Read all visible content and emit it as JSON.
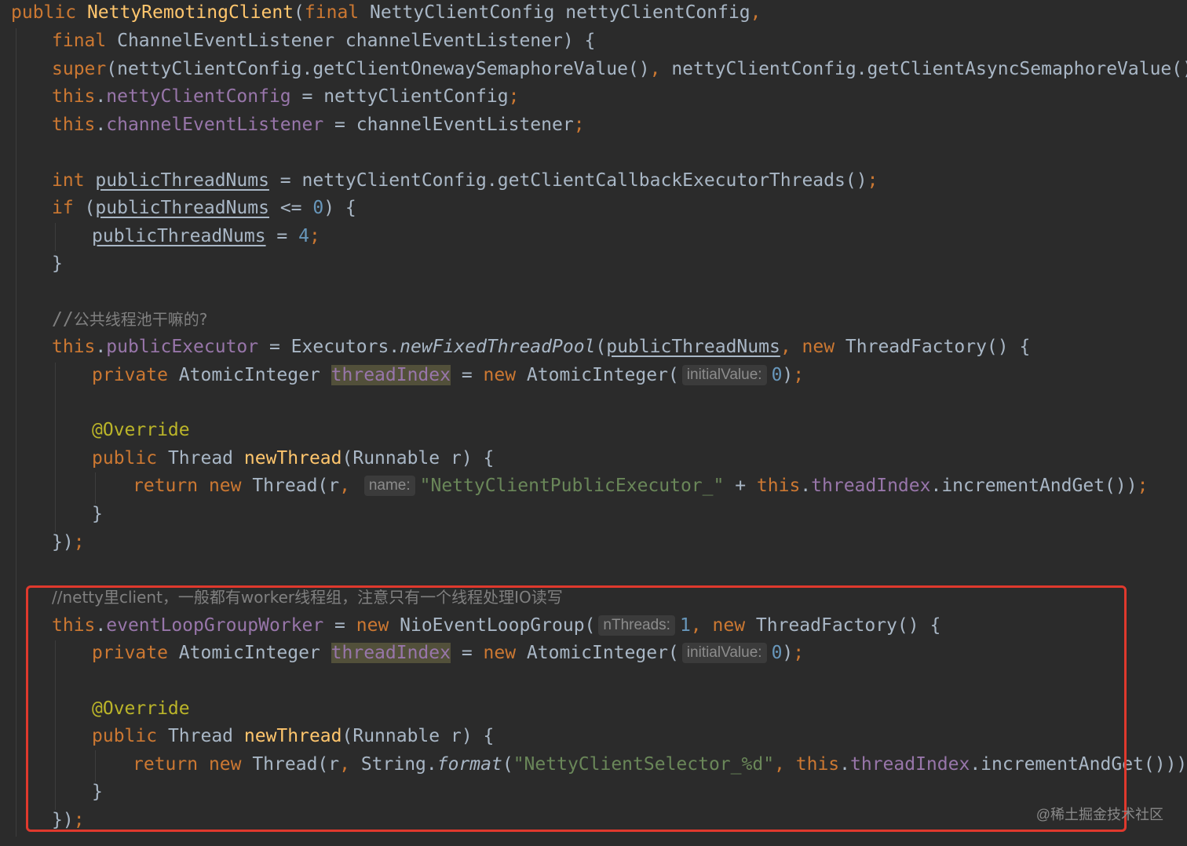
{
  "code": {
    "l1": {
      "kw_public": "public ",
      "ctor": "NettyRemotingClient",
      "lp": "(",
      "kw_final": "final ",
      "rest": "NettyClientConfig nettyClientConfig",
      "comma": ","
    },
    "l2": {
      "kw_final": "final ",
      "rest": "ChannelEventListener channelEventListener) {"
    },
    "l3": {
      "kw_super": "super",
      "mid": "(nettyClientConfig.getClientOnewaySemaphoreValue()",
      "comma": ", ",
      "rest": "nettyClientConfig.getClientAsyncSemaphoreValue())",
      "semi": ";"
    },
    "l4": {
      "this": "this",
      "dot": ".",
      "field": "nettyClientConfig",
      "rest": " = nettyClientConfig",
      "semi": ";"
    },
    "l5": {
      "this": "this",
      "dot": ".",
      "field": "channelEventListener",
      "rest": " = channelEventListener",
      "semi": ";"
    },
    "l6": {
      "kw_int": "int ",
      "var": "publicThreadNums",
      "rest": " = nettyClientConfig.getClientCallbackExecutorThreads()",
      "semi": ";"
    },
    "l7": {
      "kw_if": "if ",
      "lp": "(",
      "var": "publicThreadNums",
      "op": " <= ",
      "num": "0",
      "rest": ") {"
    },
    "l8": {
      "var": "publicThreadNums",
      "op": " = ",
      "num": "4",
      "semi": ";"
    },
    "l9": {
      "brace": "}"
    },
    "l10": {
      "comment_slashes": "//",
      "comment_text": "公共线程池干嘛的?"
    },
    "l11": {
      "this": "this",
      "dot": ".",
      "field": "publicExecutor",
      "mid": " = Executors.",
      "method": "newFixedThreadPool",
      "lp": "(",
      "var": "publicThreadNums",
      "comma": ", ",
      "kw_new": "new ",
      "rest": "ThreadFactory() {"
    },
    "l12": {
      "kw_private": "private ",
      "type": "AtomicInteger ",
      "field": "threadIndex",
      "eq": " = ",
      "kw_new": "new ",
      "ctor": "AtomicInteger(",
      "hint": "initialValue:",
      "num": "0",
      "rest": ")",
      "semi": ";"
    },
    "l13": {
      "ann": "@Override"
    },
    "l14": {
      "kw_public": "public ",
      "type": "Thread ",
      "method": "newThread",
      "rest": "(Runnable r) {"
    },
    "l15": {
      "kw_return": "return ",
      "kw_new": "new ",
      "pre": "Thread(r",
      "comma": ", ",
      "hint": "name:",
      "str": "\"NettyClientPublicExecutor_\"",
      "plus": " + ",
      "this": "this",
      "dot": ".",
      "field": "threadIndex",
      "rest": ".incrementAndGet())",
      "semi": ";"
    },
    "l16": {
      "brace": "}"
    },
    "l17": {
      "close": "})",
      "semi": ";"
    },
    "l18": {
      "comment": "//netty里client，一般都有worker线程组，注意只有一个线程处理IO读写"
    },
    "l19": {
      "this": "this",
      "dot": ".",
      "field": "eventLoopGroupWorker",
      "eq": " = ",
      "kw_new": "new ",
      "ctor": "NioEventLoopGroup(",
      "hint": "nThreads:",
      "num": "1",
      "comma": ", ",
      "kw_new2": "new ",
      "rest": "ThreadFactory() {"
    },
    "l20": {
      "kw_private": "private ",
      "type": "AtomicInteger ",
      "field": "threadIndex",
      "eq": " = ",
      "kw_new": "new ",
      "ctor": "AtomicInteger(",
      "hint": "initialValue:",
      "num": "0",
      "rest": ")",
      "semi": ";"
    },
    "l21": {
      "ann": "@Override"
    },
    "l22": {
      "kw_public": "public ",
      "type": "Thread ",
      "method": "newThread",
      "rest": "(Runnable r) {"
    },
    "l23": {
      "kw_return": "return ",
      "kw_new": "new ",
      "pre": "Thread(r",
      "comma": ", ",
      "mid": "String.",
      "method": "format",
      "lp": "(",
      "str": "\"NettyClientSelector_%d\"",
      "comma2": ", ",
      "this": "this",
      "dot": ".",
      "field": "threadIndex",
      "rest": ".incrementAndGet()))",
      "semi": ";"
    },
    "l24": {
      "brace": "}"
    },
    "l25": {
      "close": "})",
      "semi": ";"
    }
  },
  "watermark": "@稀土掘金技术社区",
  "colors": {
    "background": "#2b2b2b",
    "keyword": "#cc7832",
    "field": "#9876aa",
    "method_decl": "#ffc66d",
    "string": "#6a8759",
    "number": "#6897bb",
    "comment": "#808080",
    "annotation": "#bbb529",
    "highlight_box": "#e0392d"
  }
}
